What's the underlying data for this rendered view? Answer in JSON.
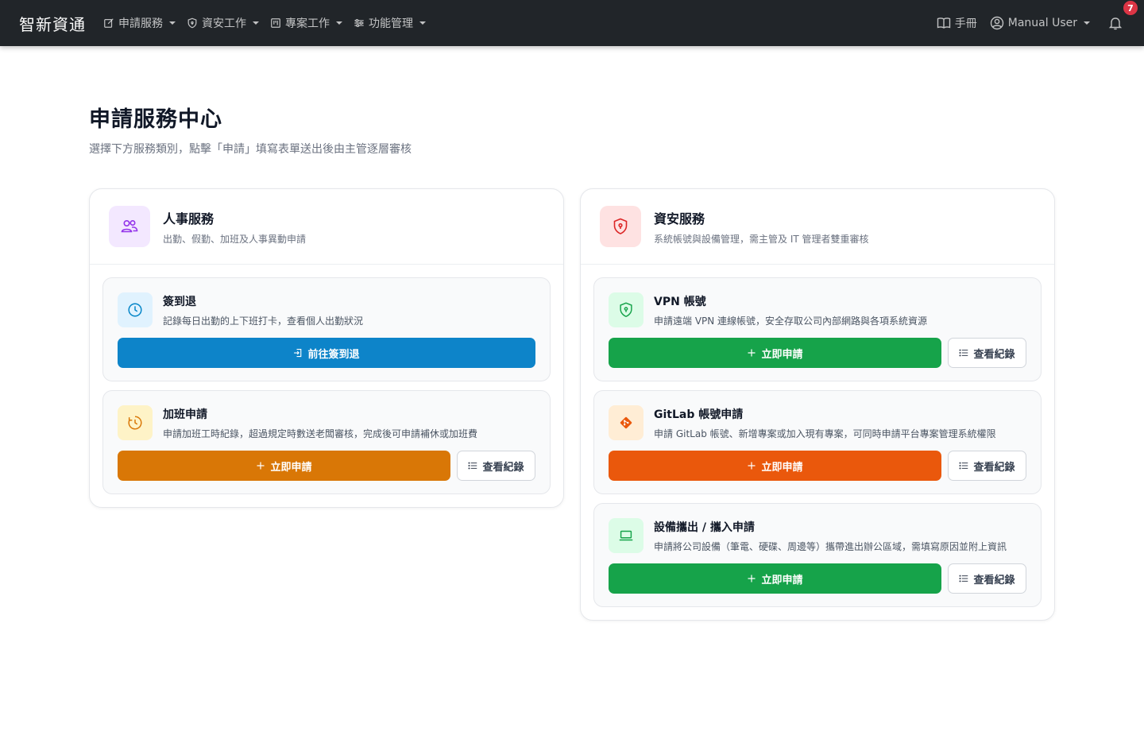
{
  "nav": {
    "brand": "智新資通",
    "menus": [
      {
        "label": "申請服務"
      },
      {
        "label": "資安工作"
      },
      {
        "label": "專案工作"
      },
      {
        "label": "功能管理"
      }
    ],
    "manual_label": "手冊",
    "user_name": "Manual User",
    "notification_count": "7"
  },
  "page": {
    "title": "申請服務中心",
    "subtitle": "選擇下方服務類別，點擊「申請」填寫表單送出後由主管逐層審核"
  },
  "hr": {
    "title": "人事服務",
    "desc": "出勤、假勤、加班及人事異動申請",
    "cards": [
      {
        "title": "簽到退",
        "desc": "記錄每日出勤的上下班打卡，查看個人出勤狀況",
        "primary": "前往簽到退"
      },
      {
        "title": "加班申請",
        "desc": "申請加班工時紀錄，超過規定時數送老闆審核，完成後可申請補休或加班費",
        "primary": "立即申請",
        "secondary": "查看紀錄"
      }
    ]
  },
  "security": {
    "title": "資安服務",
    "desc": "系統帳號與設備管理，需主管及 IT 管理者雙重審核",
    "cards": [
      {
        "title": "VPN 帳號",
        "desc": "申請遠端 VPN 連線帳號，安全存取公司內部網路與各項系統資源",
        "primary": "立即申請",
        "secondary": "查看紀錄"
      },
      {
        "title": "GitLab 帳號申請",
        "desc": "申請 GitLab 帳號、新增專案或加入現有專案，可同時申請平台專案管理系統權限",
        "primary": "立即申請",
        "secondary": "查看紀錄"
      },
      {
        "title": "設備攜出 / 攜入申請",
        "desc": "申請將公司設備（筆電、硬碟、周邊等）攜帶進出辦公區域，需填寫原因並附上資訊",
        "primary": "立即申請",
        "secondary": "查看紀錄"
      }
    ]
  },
  "colors": {
    "navbar": "#212529",
    "blue": "#0d84c9",
    "amber": "#d97706",
    "green": "#16a34a",
    "orange": "#ea580c"
  }
}
